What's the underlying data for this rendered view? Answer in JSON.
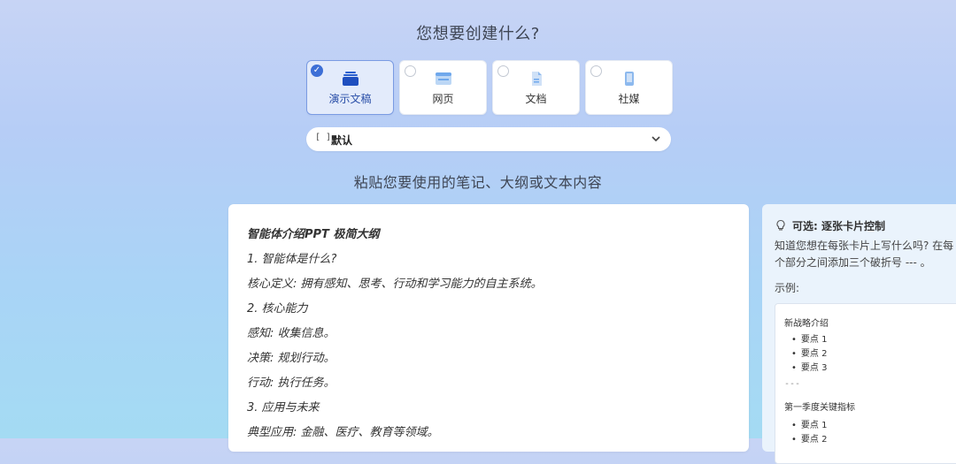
{
  "header": {
    "title": "您想要创建什么?"
  },
  "create_types": [
    {
      "label": "演示文稿",
      "icon": "presentation-stack-icon",
      "selected": true
    },
    {
      "label": "网页",
      "icon": "webpage-icon",
      "selected": false
    },
    {
      "label": "文档",
      "icon": "document-icon",
      "selected": false
    },
    {
      "label": "社媒",
      "icon": "phone-icon",
      "selected": false
    }
  ],
  "select": {
    "icon": "bracket-icon",
    "value": "默认",
    "chevron": "chevron-down-icon"
  },
  "subtitle": "粘贴您要使用的笔记、大纲或文本内容",
  "editor": {
    "lines": [
      "智能体介绍PPT 极简大纲",
      "1. 智能体是什么?",
      "核心定义: 拥有感知、思考、行动和学习能力的自主系统。",
      "2. 核心能力",
      "感知: 收集信息。",
      "决策: 规划行动。",
      "行动: 执行任务。",
      "3. 应用与未来",
      "典型应用: 金融、医疗、教育等领域。"
    ]
  },
  "tip_panel": {
    "icon": "lightbulb-icon",
    "heading": "可选: 逐张卡片控制",
    "desc_line1": "知道您想在每张卡片上写什么吗? 在每",
    "desc_line2": "个部分之间添加三个破折号 --- 。",
    "example_label": "示例:",
    "example": {
      "card1_title": "新战略介绍",
      "card1_points": [
        "要点 1",
        "要点 2",
        "要点 3"
      ],
      "separator": "---",
      "card2_title": "第一季度关键指标",
      "card2_points": [
        "要点 1",
        "要点 2"
      ]
    }
  },
  "colors": {
    "accent": "#3d6fd6",
    "selected_bg": "#e3ebfb"
  }
}
